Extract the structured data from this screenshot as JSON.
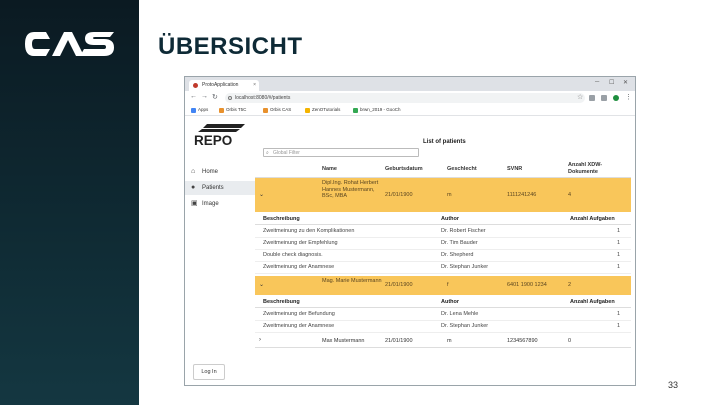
{
  "slide": {
    "title": "ÜBERSICHT",
    "page_number": "33",
    "logo_text": "CAS"
  },
  "browser": {
    "tab_title": "ProtoApplication",
    "tab_close": "×",
    "url": "localhost:8080/#/patients",
    "bookmarks": [
      "Apps",
      "Orbis T5C",
      "Orbis CAS",
      "ZenOTutorials",
      "brwn_2019 - GooCh"
    ],
    "colors": {
      "bookmark_1": "#4285f4",
      "bookmark_2": "#e8912d",
      "bookmark_3": "#e8912d",
      "bookmark_4": "#f4b400",
      "bookmark_5": "#34a853"
    }
  },
  "app": {
    "logo_text": "REPO",
    "nav": [
      {
        "label": "Home",
        "icon": "home-icon"
      },
      {
        "label": "Patients",
        "icon": "user-icon"
      },
      {
        "label": "Image",
        "icon": "image-icon"
      }
    ],
    "login_label": "Log In",
    "list_title": "List of patients",
    "filter_placeholder": "Global Filter",
    "columns": {
      "name": "Name",
      "birth": "Geburtsdatum",
      "gender": "Geschlecht",
      "svnr": "SVNR",
      "docs": "Anzahl XDW-Dokumente"
    },
    "sub_columns": {
      "desc": "Beschreibung",
      "author": "Author",
      "tasks": "Anzahl Aufgaben"
    },
    "patients": [
      {
        "name": "Dipl.Ing. Rohat Herbert Hannes Mustermann, BSc, MBA",
        "birth": "21/01/1900",
        "gender": "m",
        "svnr": "1111241246",
        "docs": "4",
        "documents": [
          {
            "desc": "Zweitmeinung zu den Komplikationen",
            "author": "Dr. Robert Fischer",
            "tasks": "1"
          },
          {
            "desc": "Zweitmeinung der Empfehlung",
            "author": "Dr. Tim Bauder",
            "tasks": "1"
          },
          {
            "desc": "Double check diagnosis.",
            "author": "Dr. Shepherd",
            "tasks": "1"
          },
          {
            "desc": "Zweitmeinung der Anamnese",
            "author": "Dr. Stephan Junker",
            "tasks": "1"
          }
        ]
      },
      {
        "name": "Mag. Marie Mustermann",
        "birth": "21/01/1900",
        "gender": "f",
        "svnr": "6401 1900 1234",
        "docs": "2",
        "documents": [
          {
            "desc": "Zweitmeinung der Befundung",
            "author": "Dr. Lena Mehle",
            "tasks": "1"
          },
          {
            "desc": "Zweitmeinung der Anamnese",
            "author": "Dr. Stephan Junker",
            "tasks": "1"
          }
        ]
      },
      {
        "name": "Max Mustermann",
        "birth": "21/01/1900",
        "gender": "m",
        "svnr": "1234567890",
        "docs": "0",
        "documents": []
      }
    ]
  }
}
